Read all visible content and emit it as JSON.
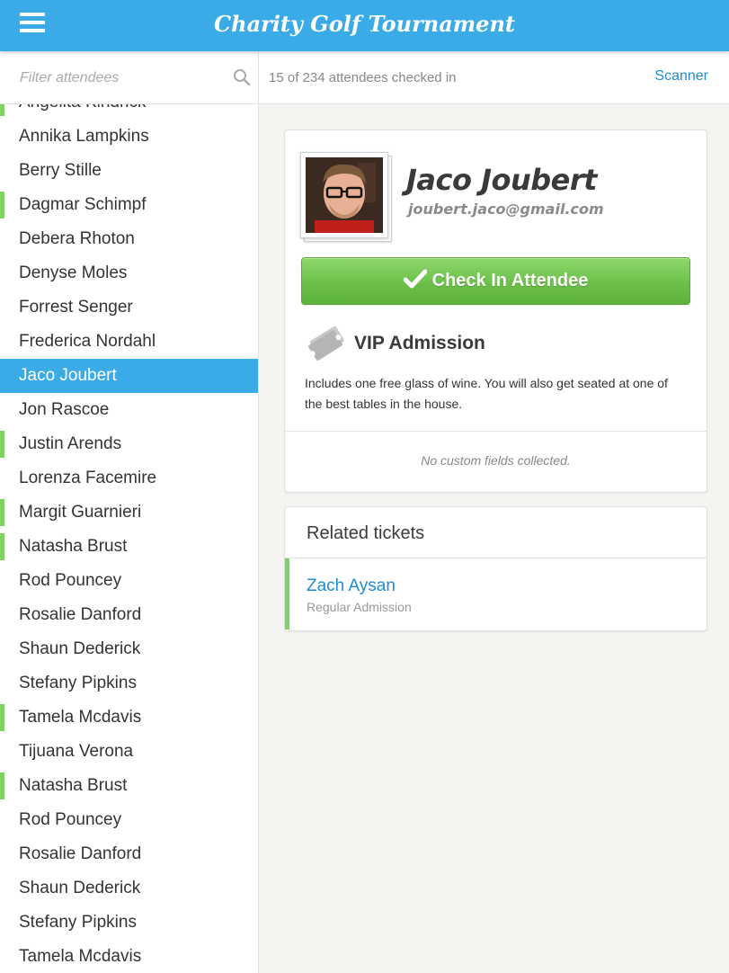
{
  "header": {
    "title": "Charity Golf Tournament",
    "menu_icon": "hamburger-menu-icon"
  },
  "toolbar": {
    "filter_placeholder": "Filter attendees",
    "filter_value": "",
    "search_icon": "search-icon",
    "checked_in_status": "15 of 234 attendees checked in",
    "scanner_label": "Scanner"
  },
  "attendees": [
    {
      "name": "Angelita Kindrick",
      "checked_in": true,
      "selected": false
    },
    {
      "name": "Annika Lampkins",
      "checked_in": false,
      "selected": false
    },
    {
      "name": "Berry Stille",
      "checked_in": false,
      "selected": false
    },
    {
      "name": "Dagmar Schimpf",
      "checked_in": true,
      "selected": false
    },
    {
      "name": "Debera Rhoton",
      "checked_in": false,
      "selected": false
    },
    {
      "name": "Denyse Moles",
      "checked_in": false,
      "selected": false
    },
    {
      "name": "Forrest Senger",
      "checked_in": false,
      "selected": false
    },
    {
      "name": "Frederica Nordahl",
      "checked_in": false,
      "selected": false
    },
    {
      "name": "Jaco Joubert",
      "checked_in": false,
      "selected": true
    },
    {
      "name": "Jon Rascoe",
      "checked_in": false,
      "selected": false
    },
    {
      "name": "Justin Arends",
      "checked_in": true,
      "selected": false
    },
    {
      "name": "Lorenza Facemire",
      "checked_in": false,
      "selected": false
    },
    {
      "name": "Margit Guarnieri",
      "checked_in": true,
      "selected": false
    },
    {
      "name": "Natasha Brust",
      "checked_in": true,
      "selected": false
    },
    {
      "name": "Rod Pouncey",
      "checked_in": false,
      "selected": false
    },
    {
      "name": "Rosalie Danford",
      "checked_in": false,
      "selected": false
    },
    {
      "name": "Shaun Dederick",
      "checked_in": false,
      "selected": false
    },
    {
      "name": "Stefany Pipkins",
      "checked_in": false,
      "selected": false
    },
    {
      "name": "Tamela Mcdavis",
      "checked_in": true,
      "selected": false
    },
    {
      "name": "Tijuana Verona",
      "checked_in": false,
      "selected": false
    },
    {
      "name": "Natasha Brust",
      "checked_in": true,
      "selected": false
    },
    {
      "name": "Rod Pouncey",
      "checked_in": false,
      "selected": false
    },
    {
      "name": "Rosalie Danford",
      "checked_in": false,
      "selected": false
    },
    {
      "name": "Shaun Dederick",
      "checked_in": false,
      "selected": false
    },
    {
      "name": "Stefany Pipkins",
      "checked_in": false,
      "selected": false
    },
    {
      "name": "Tamela Mcdavis",
      "checked_in": false,
      "selected": false
    }
  ],
  "detail": {
    "name": "Jaco Joubert",
    "email": "joubert.jaco@gmail.com",
    "checkin_label": "Check In Attendee",
    "ticket_icon": "ticket-icon",
    "ticket_type": "VIP Admission",
    "ticket_description": "Includes one free glass of wine. You will also get seated at one of the best tables in the house.",
    "custom_fields_message": "No custom fields collected."
  },
  "related": {
    "title": "Related tickets",
    "items": [
      {
        "name": "Zach Aysan",
        "type": "Regular Admission"
      }
    ]
  },
  "colors": {
    "header": "#3aabe6",
    "selected": "#3aabe6",
    "checked_in_bar": "#7ed35e",
    "button_green": "#6cc04a",
    "link": "#1f8ccf"
  }
}
